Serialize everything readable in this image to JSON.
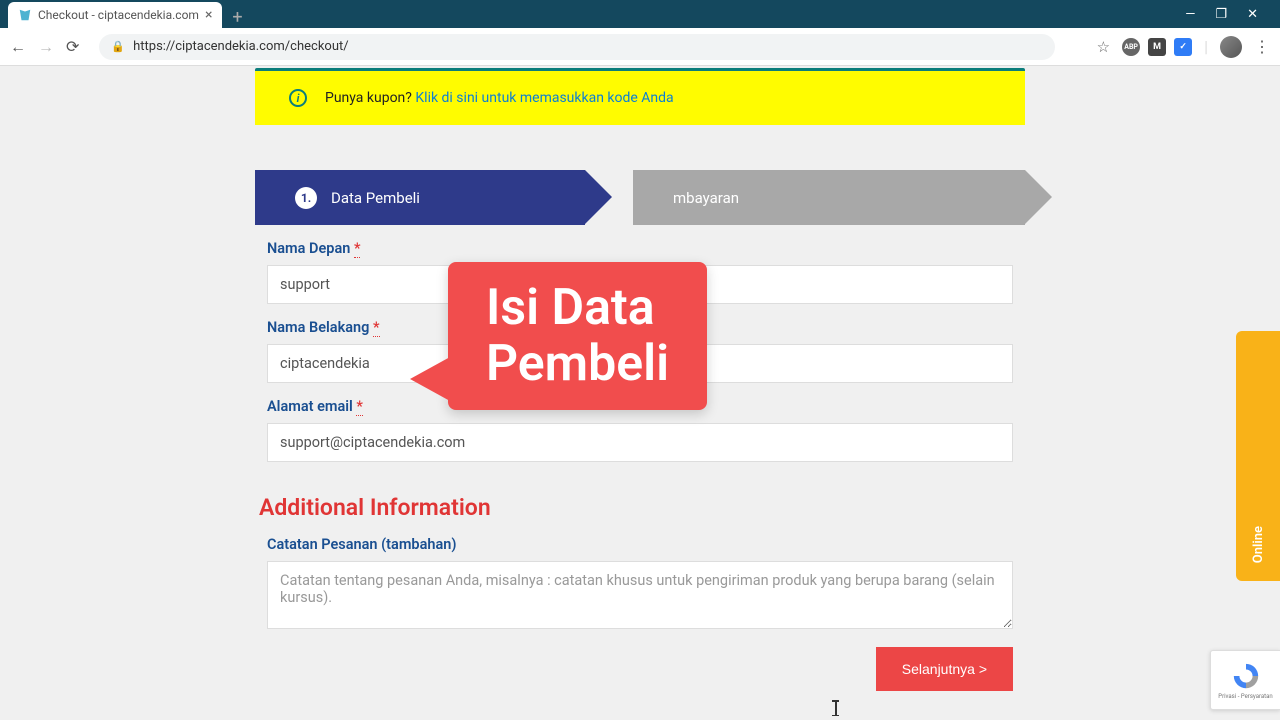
{
  "browser": {
    "tab_title": "Checkout - ciptacendekia.com",
    "url": "https://ciptacendekia.com/checkout/"
  },
  "coupon": {
    "prompt": "Punya kupon? ",
    "link": "Klik di sini untuk memasukkan kode Anda"
  },
  "steps": {
    "s1_num": "1.",
    "s1_label": "Data Pembeli",
    "s2_label": "mbayaran"
  },
  "form": {
    "first_name_label": "Nama Depan ",
    "first_name_value": "support",
    "last_name_label": "Nama Belakang ",
    "last_name_value": "ciptacendekia",
    "email_label": "Alamat email ",
    "email_value": "support@ciptacendekia.com",
    "additional_title": "Additional Information",
    "notes_label": "Catatan Pesanan (tambahan)",
    "notes_placeholder": "Catatan tentang pesanan Anda, misalnya : catatan khusus untuk pengiriman produk yang berupa barang (selain kursus).",
    "next_button": "Selanjutnya  >"
  },
  "callout": {
    "line1": "Isi Data",
    "line2": "Pembeli"
  },
  "side": {
    "online": "Online"
  },
  "recaptcha": {
    "privacy": "Privasi - Persyaratan"
  }
}
